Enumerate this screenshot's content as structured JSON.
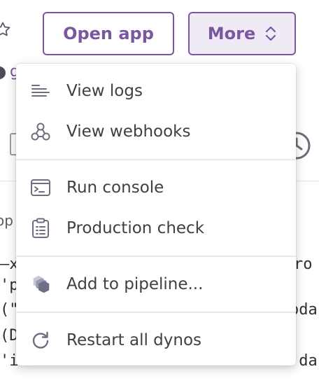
{
  "header": {
    "open_app_label": "Open app",
    "more_label": "More"
  },
  "background": {
    "fragment_g": "g",
    "fragment_op": "op",
    "code_lines": [
      {
        "left": "–x",
        "right": "ro"
      },
      {
        "left": "'p",
        "right": ""
      },
      {
        "left": "(\"",
        "right": "oda"
      },
      {
        "left": "(D",
        "right": ""
      },
      {
        "left": "'i",
        "right": "'da"
      },
      {
        "left": "",
        "right": ""
      }
    ]
  },
  "menu": {
    "items": [
      {
        "label": "View logs",
        "icon": "logs-icon"
      },
      {
        "label": "View webhooks",
        "icon": "webhooks-icon"
      },
      {
        "label": "Run console",
        "icon": "console-icon"
      },
      {
        "label": "Production check",
        "icon": "clipboard-check-icon"
      },
      {
        "label": "Add to pipeline...",
        "icon": "pipeline-icon"
      },
      {
        "label": "Restart all dynos",
        "icon": "restart-icon"
      }
    ]
  },
  "colors": {
    "accent": "#79589f",
    "more_button_bg": "#efeaf6",
    "text": "#3f3f44",
    "icon": "#5a5a6e"
  }
}
